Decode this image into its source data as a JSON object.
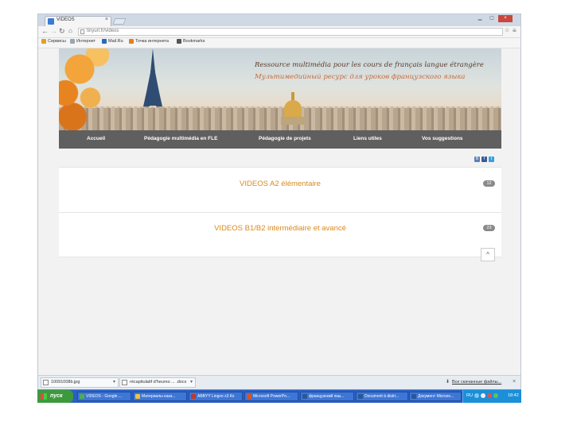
{
  "browser": {
    "tab_title": "VIDEOS",
    "url": "tinyurl.fr/videos",
    "bookmarks": [
      {
        "label": "Сервисы",
        "color": "#e0a020"
      },
      {
        "label": "Интернет",
        "color": "#9aa5b5"
      },
      {
        "label": "Mail.Ru",
        "color": "#2a6ab8"
      },
      {
        "label": "Точка интернета",
        "color": "#e08020"
      },
      {
        "label": "Bookmarks",
        "color": "#555555"
      }
    ]
  },
  "site": {
    "tagline_fr": "Ressource multimédia pour les cours de français langue étrangère",
    "tagline_ru": "Мультимедийный ресурс для уроков французского языка",
    "nav": [
      {
        "label": "Accueil"
      },
      {
        "label": "Pédagogie multimédia en FLE"
      },
      {
        "label": "Pédagogie de projets"
      },
      {
        "label": "Liens utiles"
      },
      {
        "label": "Vos suggestions"
      }
    ],
    "social": [
      {
        "label": "B",
        "color": "#5b7fb4"
      },
      {
        "label": "f",
        "color": "#3b5998"
      },
      {
        "label": "t",
        "color": "#3aa0d8"
      }
    ],
    "categories": [
      {
        "label": "VIDEOS A2 élémentaire",
        "count": "12"
      },
      {
        "label": "VIDEOS B1/B2 intermédiaire et avancé",
        "count": "23"
      }
    ],
    "scroll_top": "^"
  },
  "downloads": {
    "items": [
      {
        "name": "10091008b.jpg"
      },
      {
        "name": "récapitulatif d'heures ... .docx"
      }
    ],
    "show_all": "Все скачанные файлы..."
  },
  "taskbar": {
    "start": "пуск",
    "tasks": [
      {
        "label": "VIDEOS - Google ...",
        "color": "#4caf50"
      },
      {
        "label": "Материалы каза...",
        "color": "#f0c040"
      },
      {
        "label": "ABBYY Lingvo x3 Ко",
        "color": "#c0392b"
      },
      {
        "label": "Microsoft PowerPo...",
        "color": "#d9541e"
      },
      {
        "label": "французский язы...",
        "color": "#2b5797"
      },
      {
        "label": "Document à distri...",
        "color": "#2b5797"
      },
      {
        "label": "Документ Microso...",
        "color": "#2b5797"
      }
    ],
    "lang": "RU",
    "time": "18:42"
  }
}
